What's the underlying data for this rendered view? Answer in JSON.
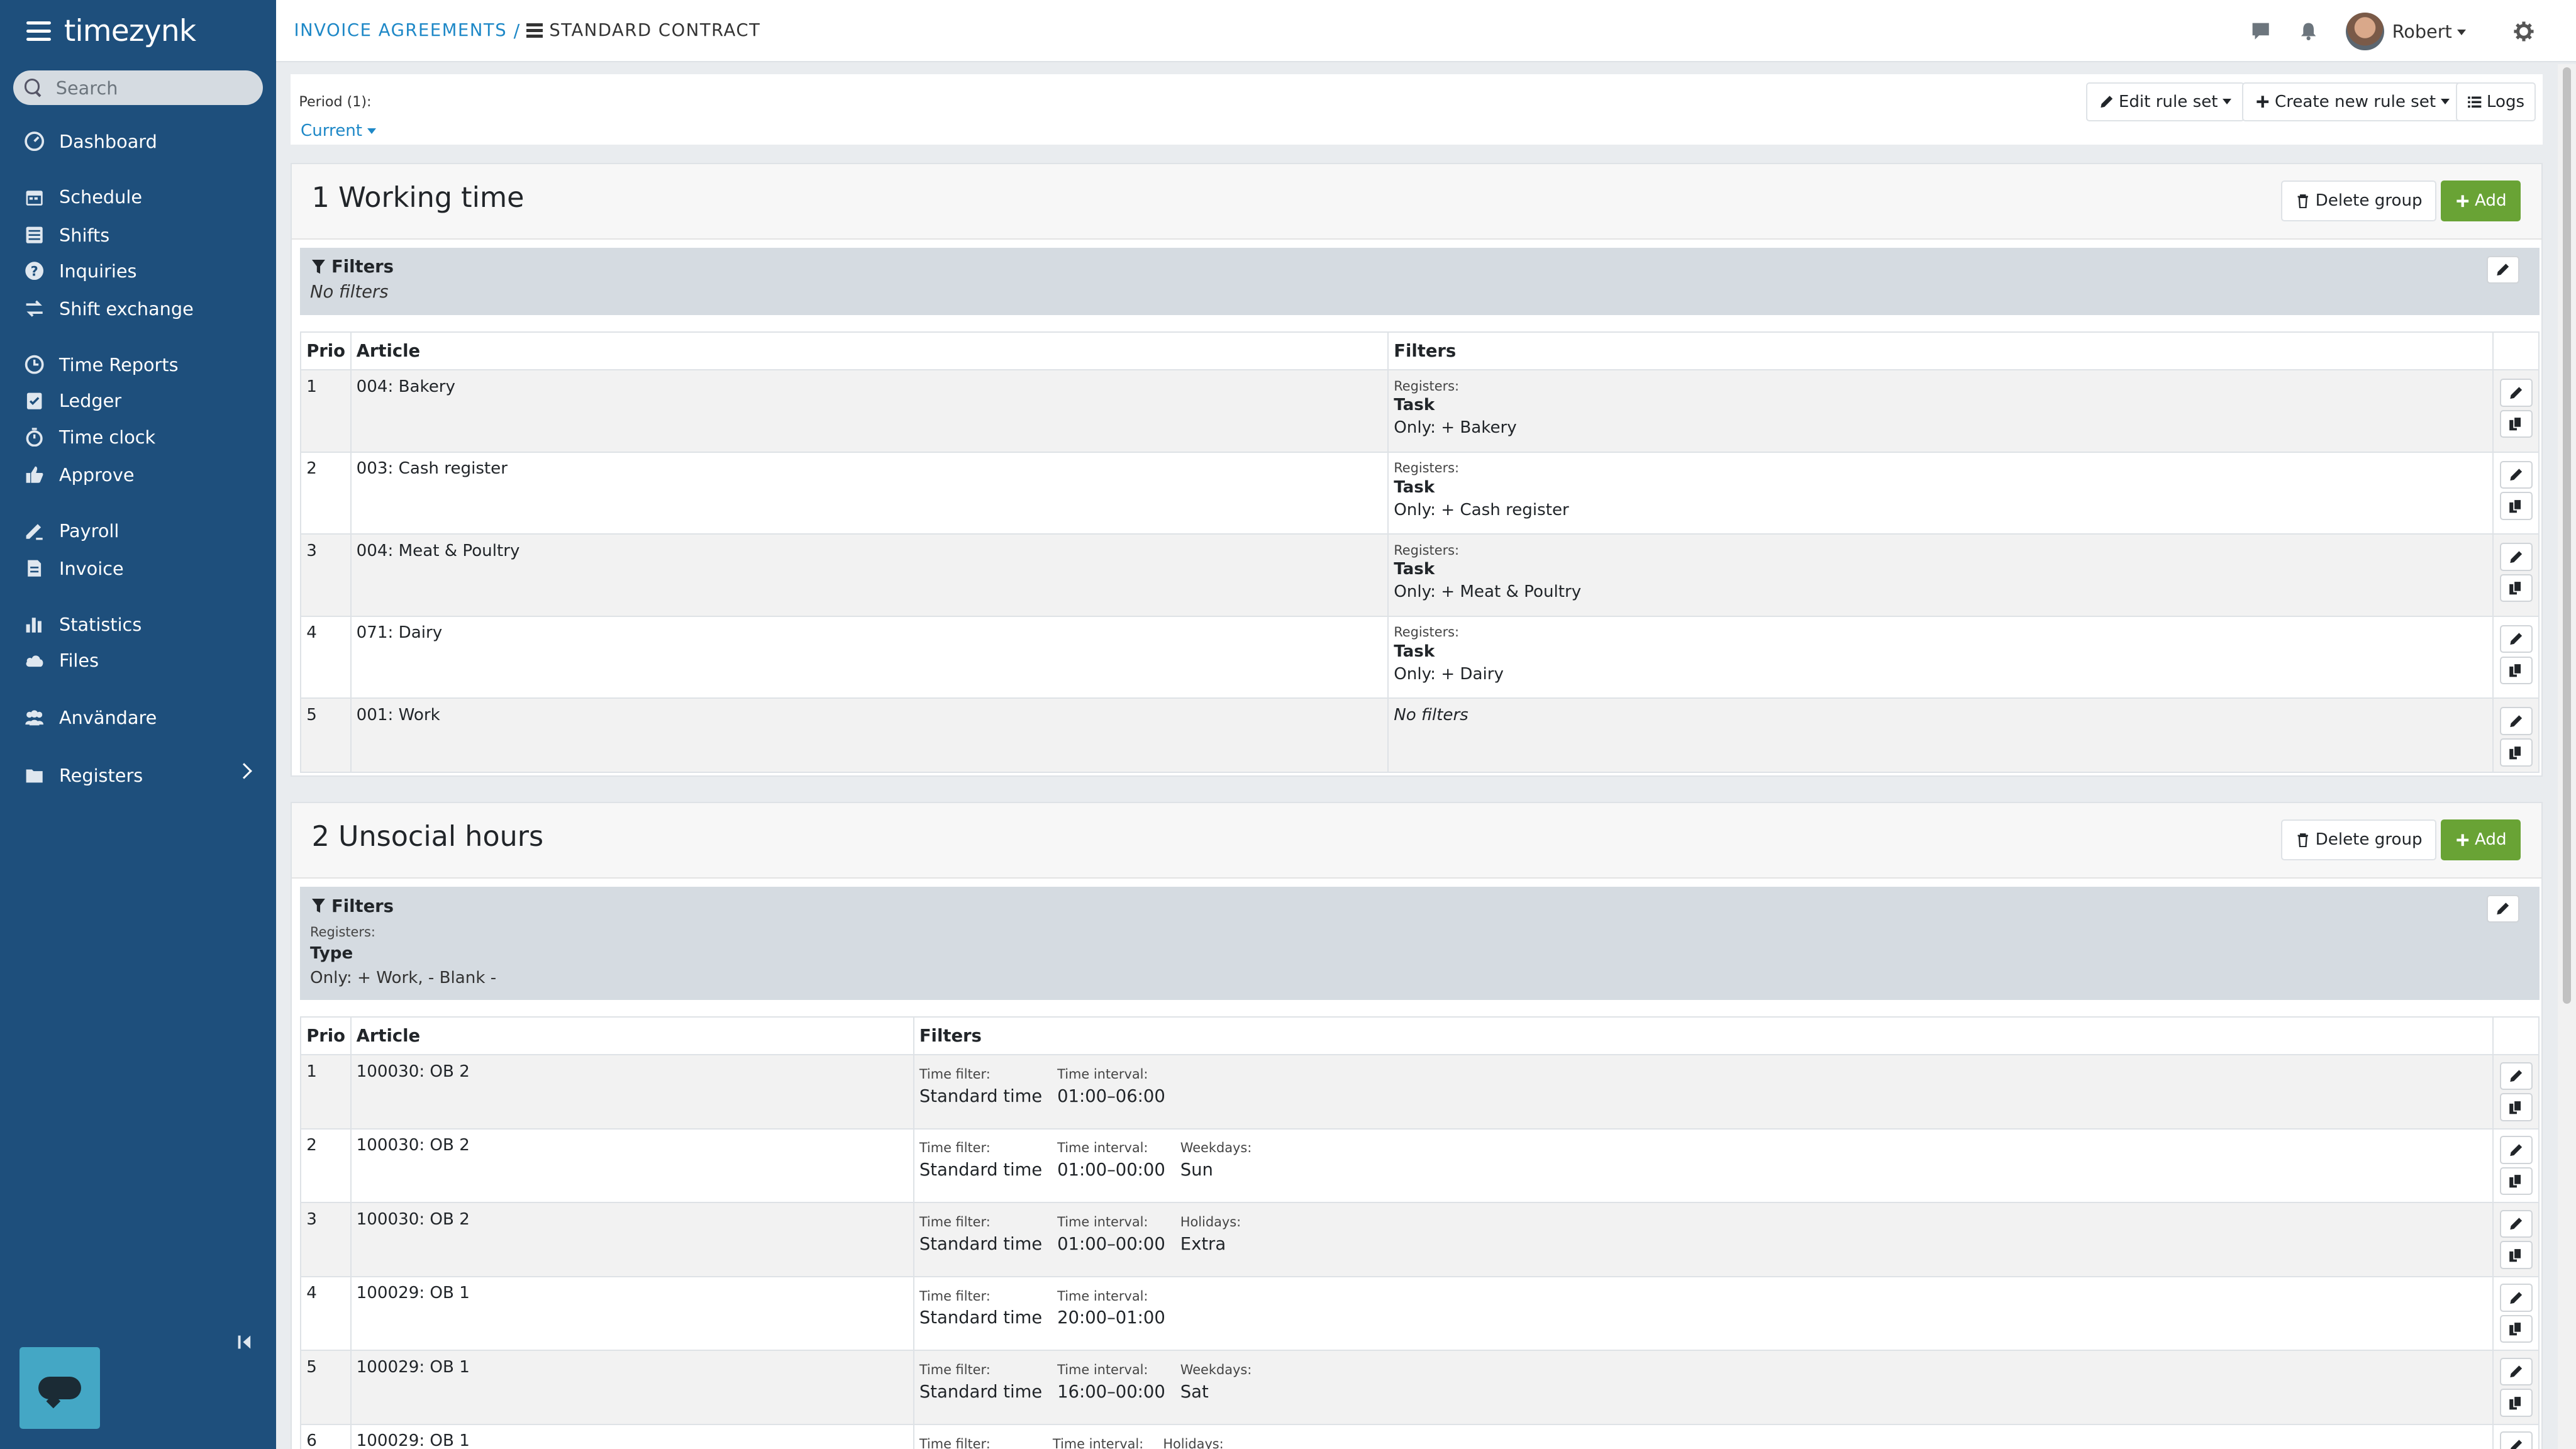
{
  "app": {
    "brand": "timezynk",
    "search_placeholder": "Search"
  },
  "sidebar": {
    "items": [
      {
        "label": "Dashboard",
        "icon": "dashboard-icon"
      },
      {
        "label": "Schedule",
        "icon": "calendar-icon"
      },
      {
        "label": "Shifts",
        "icon": "shifts-icon"
      },
      {
        "label": "Inquiries",
        "icon": "question-icon"
      },
      {
        "label": "Shift exchange",
        "icon": "exchange-icon"
      },
      {
        "label": "Time Reports",
        "icon": "clock-icon"
      },
      {
        "label": "Ledger",
        "icon": "ledger-icon"
      },
      {
        "label": "Time clock",
        "icon": "stopwatch-icon"
      },
      {
        "label": "Approve",
        "icon": "thumbs-up-icon"
      },
      {
        "label": "Payroll",
        "icon": "payroll-icon"
      },
      {
        "label": "Invoice",
        "icon": "invoice-icon"
      },
      {
        "label": "Statistics",
        "icon": "bar-chart-icon"
      },
      {
        "label": "Files",
        "icon": "cloud-icon"
      },
      {
        "label": "Användare",
        "icon": "users-icon"
      },
      {
        "label": "Registers",
        "icon": "folder-icon"
      }
    ]
  },
  "header": {
    "breadcrumb_link": "INVOICE AGREEMENTS",
    "breadcrumb_sep": "/",
    "breadcrumb_current": "STANDARD CONTRACT",
    "user": "Robert"
  },
  "period": {
    "label": "Period (1):",
    "value": "Current",
    "edit_rule_set": "Edit rule set",
    "create_rule_set": "Create new rule set",
    "logs": "Logs"
  },
  "groups": [
    {
      "title": "1 Working time",
      "delete_label": "Delete group",
      "add_label": "Add",
      "filters_title": "Filters",
      "filters_text": "No filters",
      "columns": [
        "Prio",
        "Article",
        "Filters"
      ],
      "rows": [
        {
          "prio": "1",
          "article": "004: Bakery",
          "reg_label": "Registers:",
          "reg_name": "Task",
          "reg_value": "Only: + Bakery"
        },
        {
          "prio": "2",
          "article": "003: Cash register",
          "reg_label": "Registers:",
          "reg_name": "Task",
          "reg_value": "Only: + Cash register"
        },
        {
          "prio": "3",
          "article": "004: Meat & Poultry",
          "reg_label": "Registers:",
          "reg_name": "Task",
          "reg_value": "Only: + Meat & Poultry"
        },
        {
          "prio": "4",
          "article": "071: Dairy",
          "reg_label": "Registers:",
          "reg_name": "Task",
          "reg_value": "Only: + Dairy"
        },
        {
          "prio": "5",
          "article": "001: Work",
          "no_filters": "No filters"
        }
      ]
    },
    {
      "title": "2 Unsocial hours",
      "delete_label": "Delete group",
      "add_label": "Add",
      "filters_title": "Filters",
      "filters_reg_label": "Registers:",
      "filters_reg_name": "Type",
      "filters_reg_value": "Only: + Work, - Blank -",
      "columns": [
        "Prio",
        "Article",
        "Filters"
      ],
      "rows": [
        {
          "prio": "1",
          "article": "100030: OB 2",
          "tf_label": "Time filter:",
          "tf_value": "Standard time",
          "ti_label": "Time interval:",
          "ti_value": "01:00–06:00"
        },
        {
          "prio": "2",
          "article": "100030: OB 2",
          "tf_label": "Time filter:",
          "tf_value": "Standard time",
          "ti_label": "Time interval:",
          "ti_value": "01:00–00:00",
          "extra_label": "Weekdays:",
          "extra_value": "Sun"
        },
        {
          "prio": "3",
          "article": "100030: OB 2",
          "tf_label": "Time filter:",
          "tf_value": "Standard time",
          "ti_label": "Time interval:",
          "ti_value": "01:00–00:00",
          "extra_label": "Holidays:",
          "extra_value": "Extra"
        },
        {
          "prio": "4",
          "article": "100029: OB 1",
          "tf_label": "Time filter:",
          "tf_value": "Standard time",
          "ti_label": "Time interval:",
          "ti_value": "20:00–01:00"
        },
        {
          "prio": "5",
          "article": "100029: OB 1",
          "tf_label": "Time filter:",
          "tf_value": "Standard time",
          "ti_label": "Time interval:",
          "ti_value": "16:00–00:00",
          "extra_label": "Weekdays:",
          "extra_value": "Sat"
        },
        {
          "prio": "6",
          "article": "100029: OB 1",
          "tf_label": "Time filter:",
          "tf_value": "",
          "ti_label": "Time interval:",
          "ti_value": "",
          "extra_label": "Holidays:",
          "extra_value": ""
        }
      ]
    }
  ],
  "colors": {
    "sidebar": "#1e4f7c",
    "accent_link": "#1e88c7",
    "add_button": "#69a335",
    "filters_bg": "#d5dbe1",
    "chat_widget": "#44a7c5"
  }
}
